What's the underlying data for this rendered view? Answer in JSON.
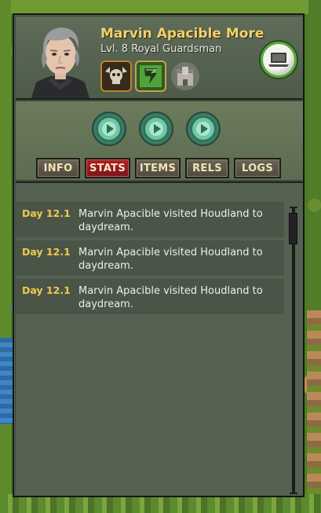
{
  "character": {
    "name": "Marvin Apacible More",
    "rank": "Lvl. 8 Royal Guardsman"
  },
  "badges": [
    {
      "icon": "skull-crest-icon",
      "color": "#d6d0c2"
    },
    {
      "icon": "green-banner-icon",
      "color": "#4fa33a"
    },
    {
      "icon": "castle-icon",
      "color": "#9e9a90"
    }
  ],
  "controls": {
    "play_buttons": [
      "play-button-1",
      "play-button-2",
      "play-button-3"
    ],
    "accent": "#4fb08c"
  },
  "tabs": [
    {
      "label": "INFO",
      "active": false
    },
    {
      "label": "STATS",
      "active": true
    },
    {
      "label": "ITEMS",
      "active": false
    },
    {
      "label": "RELS",
      "active": false
    },
    {
      "label": "LOGS",
      "active": false
    }
  ],
  "logs": [
    {
      "day": "Day 12.1",
      "text": "Marvin Apacible visited Houdland to daydream."
    },
    {
      "day": "Day 12.1",
      "text": "Marvin Apacible visited Houdland to daydream."
    },
    {
      "day": "Day 12.1",
      "text": "Marvin Apacible visited Houdland to daydream."
    }
  ],
  "colors": {
    "name_gold": "#f2d16b",
    "day_gold": "#f2c94c",
    "active_tab": "#a8222a",
    "panel_bg": "#556251"
  }
}
